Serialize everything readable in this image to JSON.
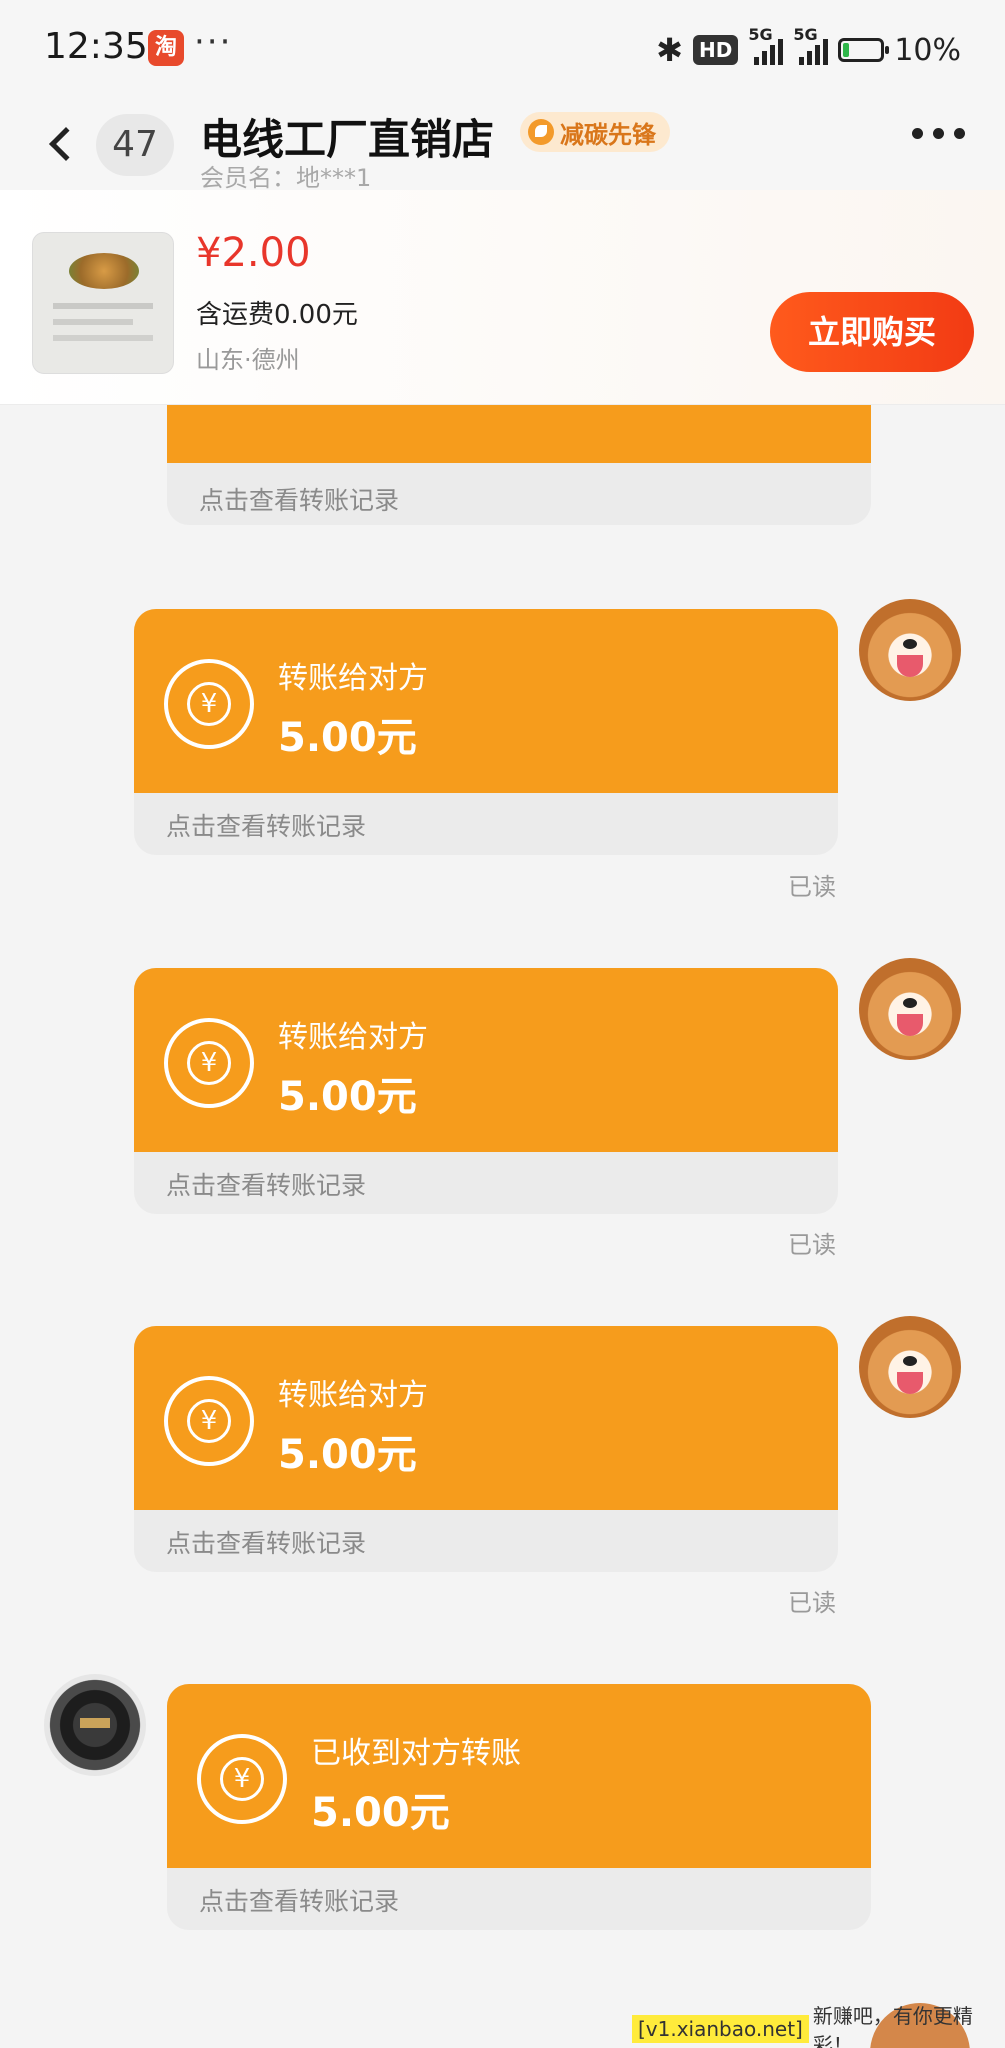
{
  "status_bar": {
    "time": "12:35",
    "app_icon_char": "淘",
    "dots": "···",
    "hd": "HD",
    "net1": "5G",
    "net2": "5G",
    "battery": "10%"
  },
  "header": {
    "unread_count": "47",
    "shop_name": "电线工厂直销店",
    "badge": "减碳先锋",
    "member": "会员名：地***1"
  },
  "product": {
    "price": "¥2.00",
    "shipping": "含运费0.00元",
    "location": "山东·德州",
    "buy_label": "立即购买"
  },
  "messages": [
    {
      "title": "转账给对方",
      "amount": "5.00元",
      "footer": "点击查看转账记录",
      "read": "已读"
    },
    {
      "title": "转账给对方",
      "amount": "5.00元",
      "footer": "点击查看转账记录",
      "read": "已读"
    },
    {
      "title": "转账给对方",
      "amount": "5.00元",
      "footer": "点击查看转账记录",
      "read": "已读"
    },
    {
      "title": "已收到对方转账",
      "amount": "5.00元",
      "footer": "点击查看转账记录"
    }
  ],
  "partial_message": {
    "footer": "点击查看转账记录"
  },
  "watermark": {
    "site": "[v1.xianbao.net]",
    "text": " 新赚吧，有你更精彩！"
  },
  "colors": {
    "bubble": "#f69c1c",
    "buy_button": "#f23b14",
    "price": "#e8362b"
  }
}
